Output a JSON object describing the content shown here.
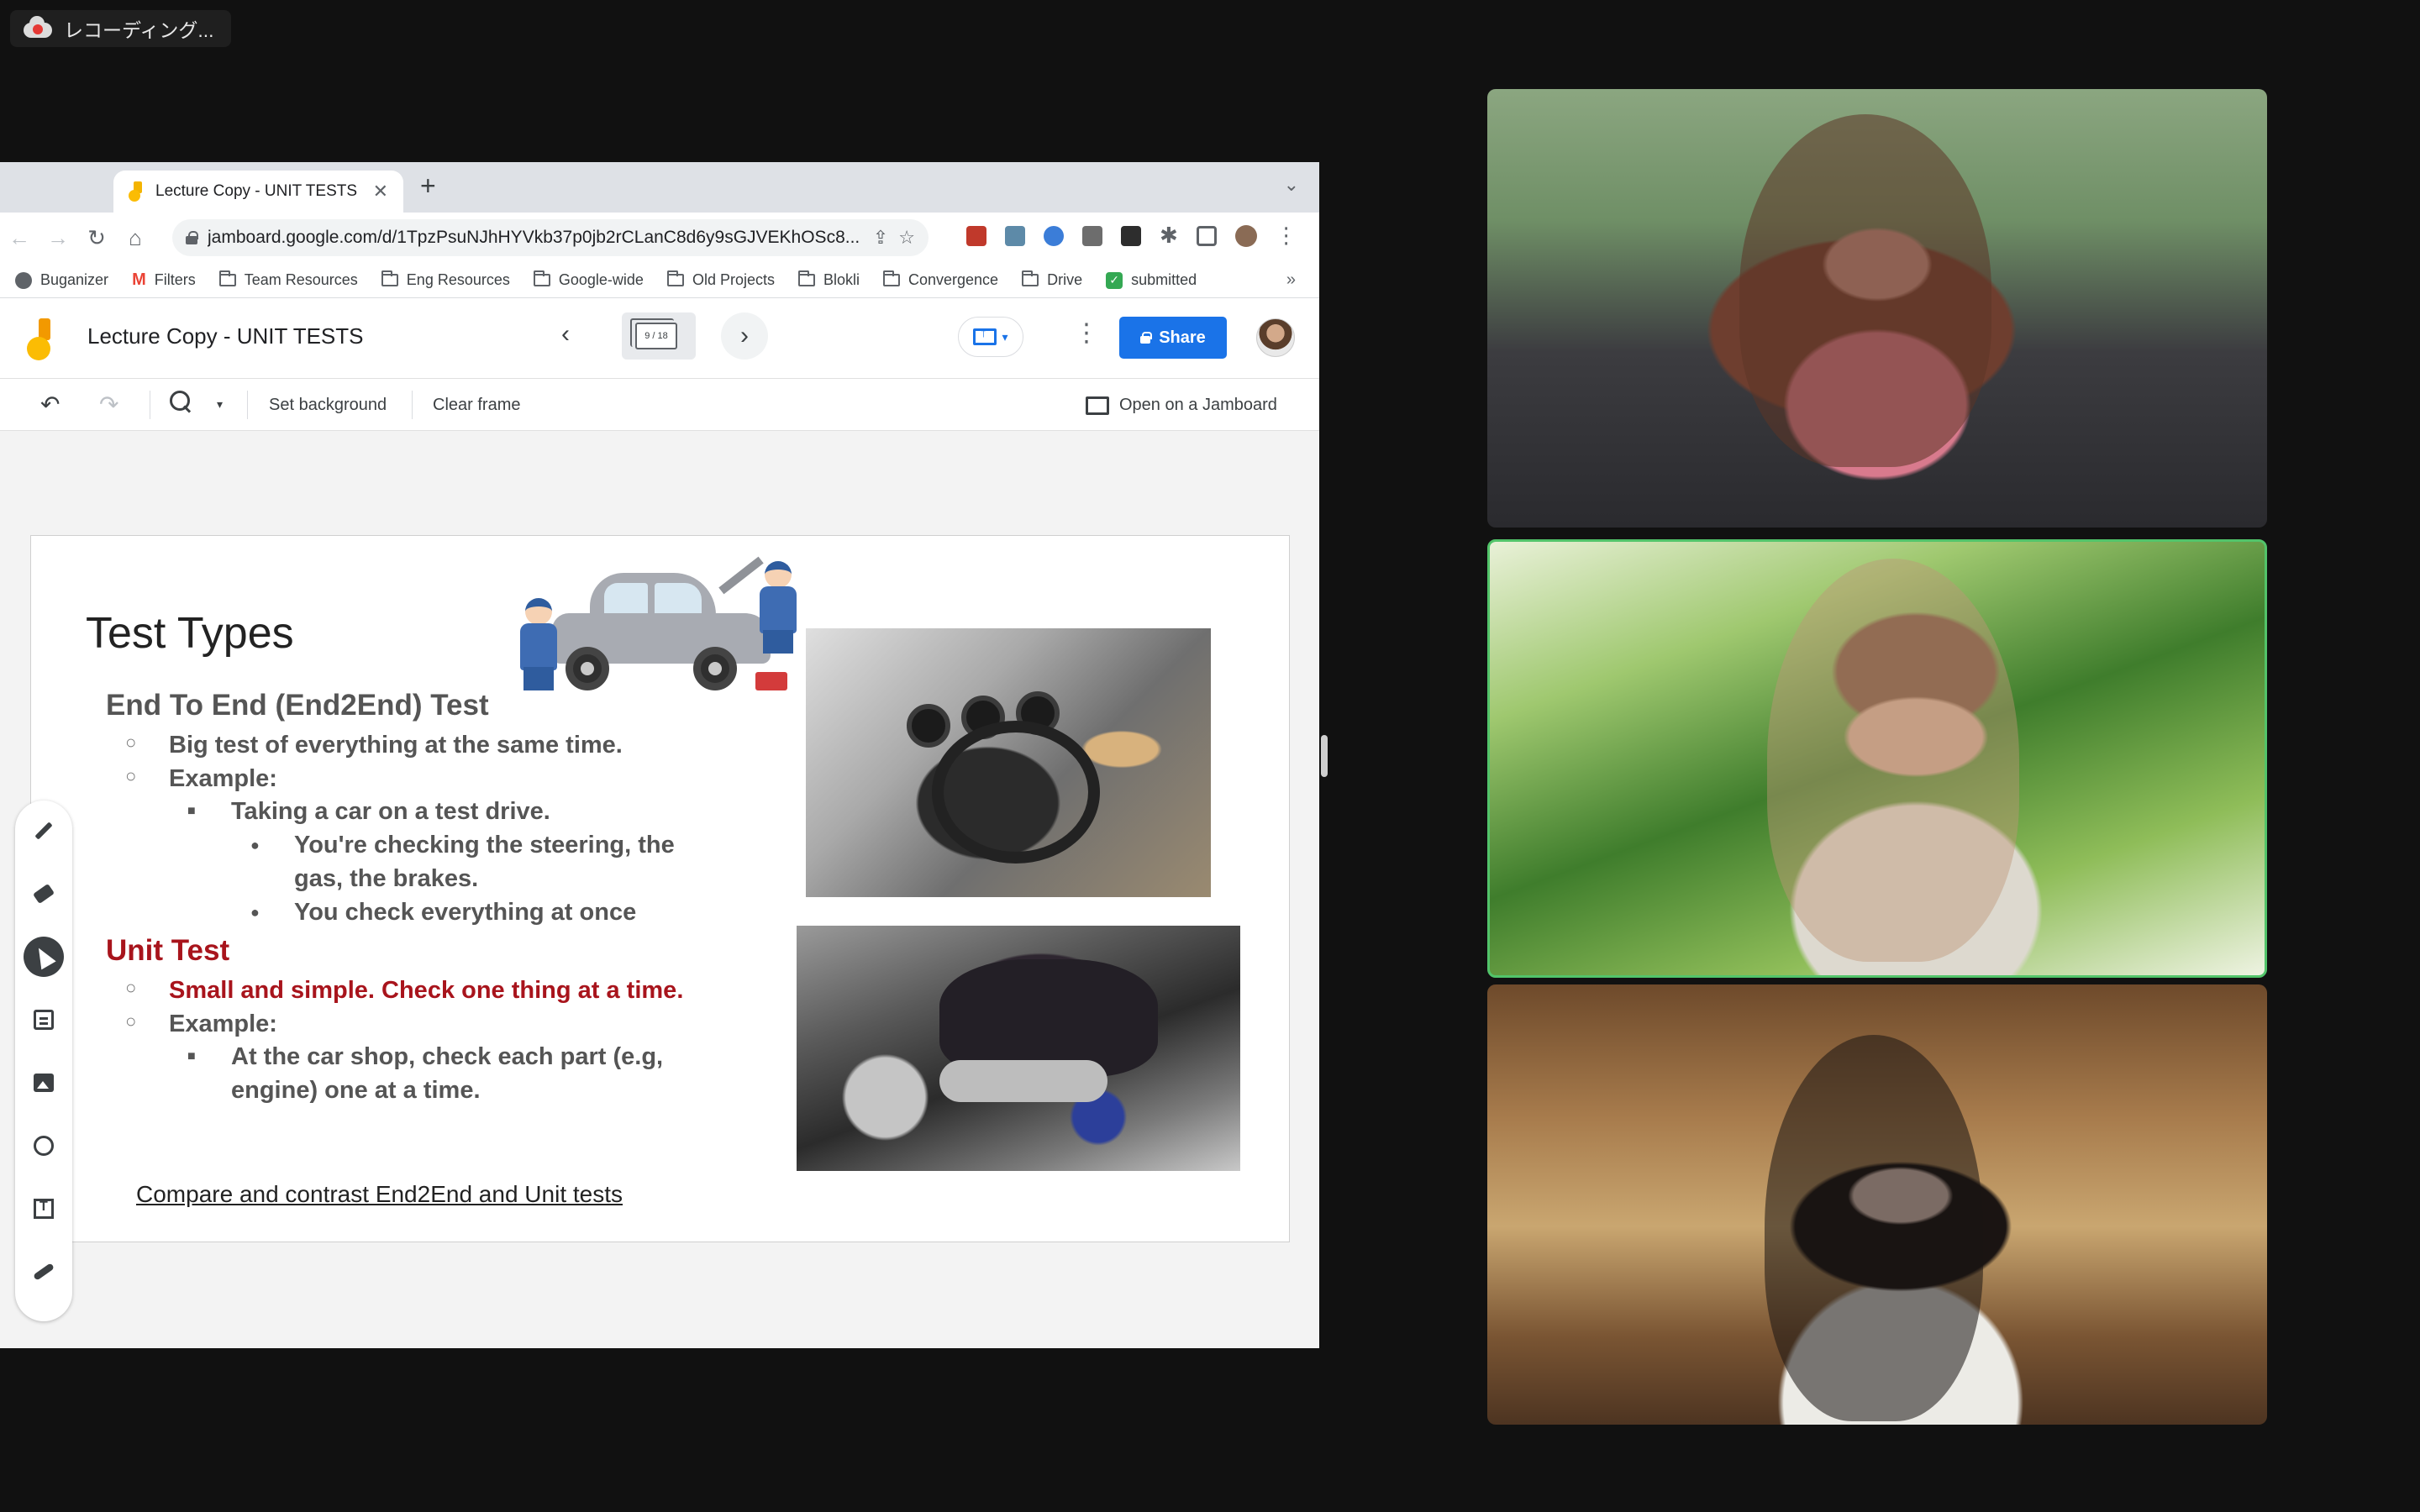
{
  "recording": {
    "label": "レコーディング..."
  },
  "browser": {
    "tab_title": "Lecture Copy - UNIT TESTS - ",
    "url": "jamboard.google.com/d/1TpzPsuNJhHYVkb37p0jb2rCLanC8d6y9sGJVEKhOSc8...",
    "bookmarks": [
      "Buganizer",
      "Filters",
      "Team Resources",
      "Eng Resources",
      "Google-wide",
      "Old Projects",
      "Blokli",
      "Convergence",
      "Drive",
      "submitted"
    ],
    "bookmarks_overflow": "»"
  },
  "jamboard": {
    "doc_title": "Lecture Copy - UNIT TESTS",
    "frame_counter": "9 / 18",
    "share_label": "Share",
    "toolbar": {
      "set_background": "Set background",
      "clear_frame": "Clear frame",
      "open_on_jamboard": "Open on a Jamboard"
    }
  },
  "slide": {
    "title": "Test Types",
    "e2e": {
      "heading": "End To End (End2End) Test",
      "bullet_1": "Big test of everything at the same time.",
      "bullet_2": "Example:",
      "sub_1": "Taking a car on a test drive.",
      "detail_1": "You're checking the steering, the",
      "detail_1b": "gas, the brakes.",
      "detail_2": "You check everything at once"
    },
    "unit": {
      "heading": "Unit Test",
      "bullet_1": "Small and simple. Check one thing at a time.",
      "bullet_2": "Example:",
      "sub_1": "At the car shop, check each part (e.g,",
      "sub_1b": "engine) one at a time."
    },
    "link": "Compare and contrast End2End and Unit tests"
  },
  "colors": {
    "accent_blue": "#1a73e8",
    "unit_red": "#a8141c",
    "active_speaker_border": "#52c46a",
    "background": "#111111"
  },
  "icons": [
    "cloud-record-icon",
    "lock-icon",
    "folder-icon",
    "pen-icon",
    "eraser-icon",
    "select-icon",
    "sticky-note-icon",
    "image-icon",
    "circle-icon",
    "textbox-icon",
    "laser-icon",
    "zoom-icon",
    "undo-icon",
    "redo-icon",
    "kebab-icon",
    "present-icon"
  ]
}
